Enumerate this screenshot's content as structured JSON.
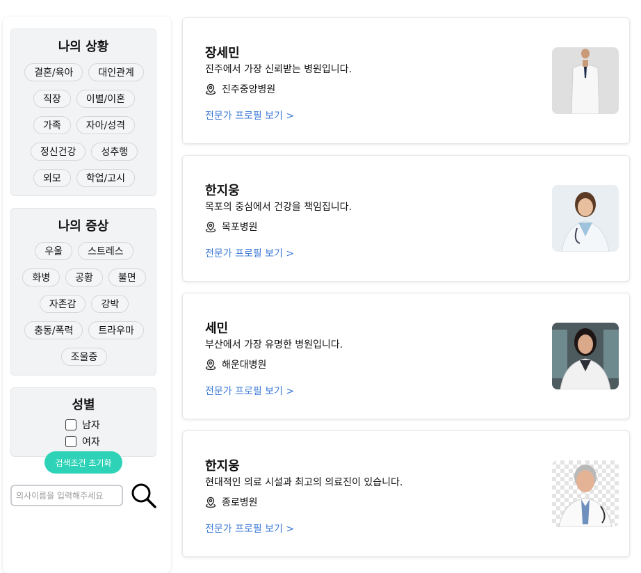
{
  "situation": {
    "title": "나의 상황",
    "tags": [
      "결혼/육아",
      "대인관계",
      "직장",
      "이별/이혼",
      "가족",
      "자아/성격",
      "정신건강",
      "성추행",
      "외모",
      "학업/고시"
    ]
  },
  "symptom": {
    "title": "나의 증상",
    "tags": [
      "우울",
      "스트레스",
      "화병",
      "공황",
      "불면",
      "자존감",
      "강박",
      "충동/폭력",
      "트라우마",
      "조울증"
    ]
  },
  "gender": {
    "title": "성별",
    "options": [
      "남자",
      "여자"
    ]
  },
  "reset_label": "검색조건 초기화",
  "search": {
    "placeholder": "의사이름을 입력해주세요"
  },
  "doctors": [
    {
      "name": "장세민",
      "desc": "진주에서 가장 신뢰받는 병원입니다.",
      "hospital": "진주중앙병원",
      "link": "전문가 프로필 보기 >"
    },
    {
      "name": "한지웅",
      "desc": "목포의 중심에서 건강을 책임집니다.",
      "hospital": "목포병원",
      "link": "전문가 프로필 보기 >"
    },
    {
      "name": "세민",
      "desc": "부산에서 가장 유명한 병원입니다.",
      "hospital": "해운대병원",
      "link": "전문가 프로필 보기 >"
    },
    {
      "name": "한지웅",
      "desc": "현대적인 의료 시설과 최고의 의료진이 있습니다.",
      "hospital": "종로병원",
      "link": "전문가 프로필 보기 >"
    }
  ],
  "colors": {
    "accent": "#2ed3b7",
    "link": "#3d7ad6",
    "panel": "#f2f3f5"
  }
}
